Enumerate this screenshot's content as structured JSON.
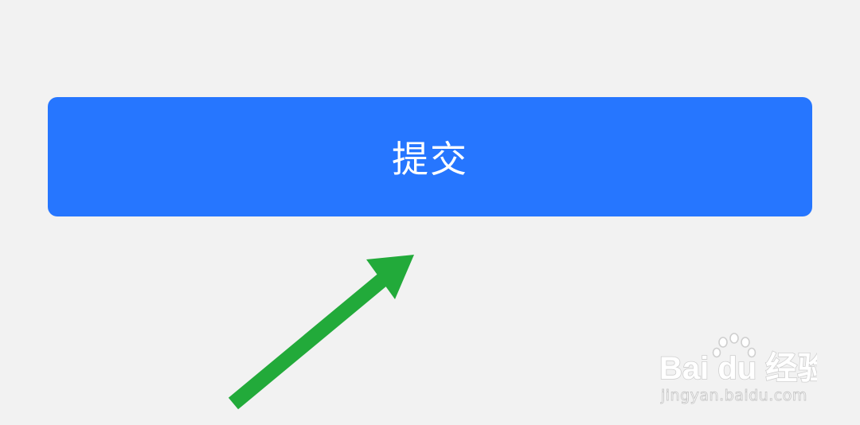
{
  "submit_button": {
    "label": "提交"
  },
  "watermark": {
    "logo_text": "Bai du 经验",
    "url": "jingyan.baidu.com"
  },
  "colors": {
    "background": "#f2f2f2",
    "button": "#2676ff",
    "button_text": "#ffffff",
    "arrow": "#22aa3a"
  }
}
